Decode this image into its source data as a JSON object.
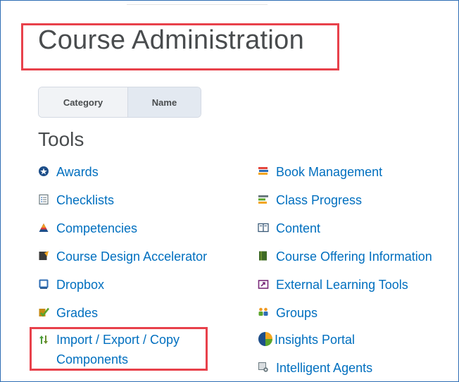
{
  "header": {
    "title": "Course Administration"
  },
  "view_toggle": {
    "category_label": "Category",
    "name_label": "Name"
  },
  "section": {
    "title": "Tools"
  },
  "tools_left": [
    {
      "label": "Awards",
      "icon": "award-icon"
    },
    {
      "label": "Checklists",
      "icon": "checklist-icon"
    },
    {
      "label": "Competencies",
      "icon": "competencies-icon"
    },
    {
      "label": "Course Design Accelerator",
      "icon": "course-design-icon"
    },
    {
      "label": "Dropbox",
      "icon": "dropbox-icon"
    },
    {
      "label": "Grades",
      "icon": "grades-icon"
    },
    {
      "label": "Import / Export / Copy Components",
      "icon": "import-export-icon"
    }
  ],
  "tools_right": [
    {
      "label": "Book Management",
      "icon": "books-icon"
    },
    {
      "label": "Class Progress",
      "icon": "class-progress-icon"
    },
    {
      "label": "Content",
      "icon": "content-icon"
    },
    {
      "label": "Course Offering Information",
      "icon": "course-offering-icon"
    },
    {
      "label": "External Learning Tools",
      "icon": "external-tools-icon"
    },
    {
      "label": "Groups",
      "icon": "groups-icon"
    },
    {
      "label": "Insights Portal",
      "icon": "insights-icon"
    },
    {
      "label": "Intelligent Agents",
      "icon": "intelligent-agents-icon"
    }
  ],
  "colors": {
    "link": "#006fbf",
    "highlight": "#e8414b",
    "text": "#494c4e"
  }
}
